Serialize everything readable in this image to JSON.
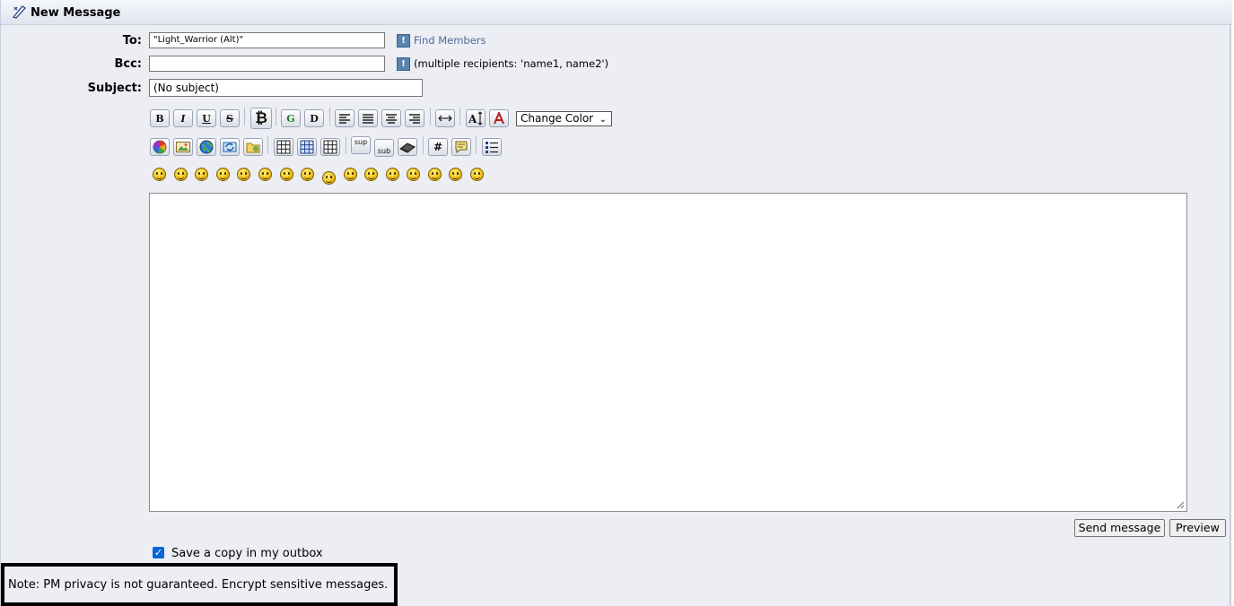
{
  "header": {
    "title": "New Message"
  },
  "form": {
    "to_label": "To:",
    "to_value": "\"Light_Warrior (Alt)\"",
    "find_members": "Find Members",
    "bcc_label": "Bcc:",
    "bcc_value": "",
    "bcc_hint": "(multiple recipients: 'name1, name2')",
    "subject_label": "Subject:",
    "subject_value": "(No subject)",
    "info_glyph": "!"
  },
  "toolbar": {
    "bold": "B",
    "italic": "I",
    "underline": "U",
    "strike": "S",
    "bitcoin": "₿",
    "g": "G",
    "d": "D",
    "hash": "#",
    "sup": "sup",
    "sub": "sub",
    "change_color": "Change Color",
    "change_color_arrow": "⌄"
  },
  "buttons": {
    "send": "Send message",
    "preview": "Preview"
  },
  "options": {
    "save_copy": "Save a copy in my outbox",
    "save_copy_checked": true,
    "check_glyph": "✓"
  },
  "note": "Note: PM privacy is not guaranteed. Encrypt sensitive messages."
}
